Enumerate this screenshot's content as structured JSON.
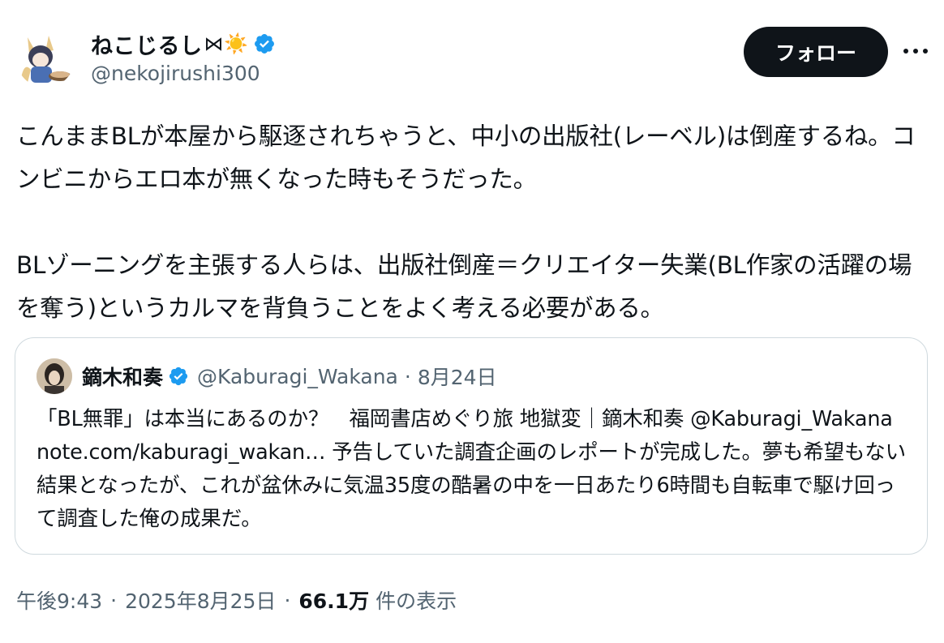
{
  "author": {
    "display_name": "ねこじるし",
    "emoji": "⋈☀️",
    "handle": "@nekojirushi300",
    "verified": true
  },
  "follow_button": {
    "label": "フォロー"
  },
  "more_menu": {
    "icon": "more-horizontal-icon"
  },
  "tweet": {
    "text": "こんままBLが本屋から駆逐されちゃうと、中小の出版社(レーベル)は倒産するね。コンビニからエロ本が無くなった時もそうだった。\n\nBLゾーニングを主張する人らは、出版社倒産＝クリエイター失業(BL作家の活躍の場を奪う)というカルマを背負うことをよく考える必要がある。"
  },
  "quoted_tweet": {
    "display_name": "鏑木和奏",
    "verified": true,
    "handle": "@Kaburagi_Wakana",
    "separator": "·",
    "date": "8月24日",
    "text": "「BL無罪」は本当にあるのか？　福岡書店めぐり旅 地獄変｜鏑木和奏 @Kaburagi_Wakana note.com/kaburagi_wakan… 予告していた調査企画のレポートが完成した。夢も希望もない結果となったが、これが盆休みに気温35度の酷暑の中を一日あたり6時間も自転車で駆け回って調査した俺の成果だ。"
  },
  "meta": {
    "time": "午後9:43",
    "date": "2025年8月25日",
    "separator": "·",
    "views": "66.1万",
    "views_label": "件の表示"
  },
  "colors": {
    "text": "#0f1419",
    "secondary": "#536471",
    "verified": "#1d9bf0",
    "border": "#cfd9de",
    "button_bg": "#0f1419"
  }
}
